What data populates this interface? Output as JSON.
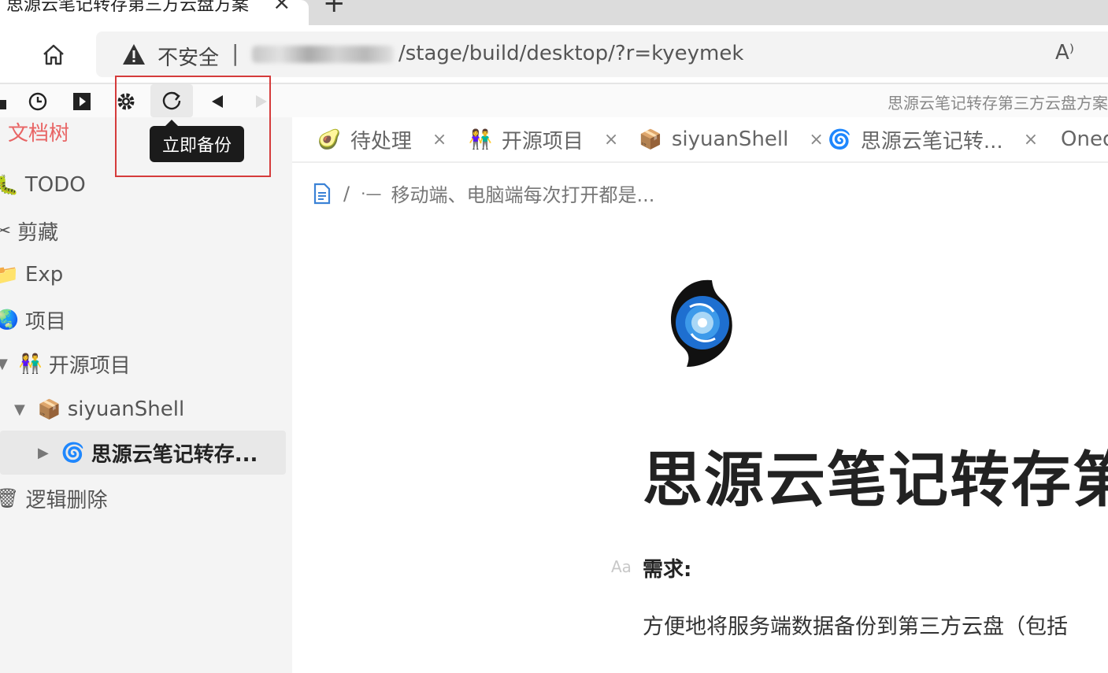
{
  "browser": {
    "tab_title": "思源云笔记转存第三方云盘方案",
    "tab_close": "×",
    "new_tab": "+",
    "insecure_label": "不安全",
    "separator": "|",
    "url_path": "/stage/build/desktop/?r=kyeymek",
    "read_aloud": "A⁾"
  },
  "toolbar": {
    "doc_title": "思源云笔记转存第三方云盘方案",
    "tooltip": "立即备份"
  },
  "sidebar": {
    "title": "文档树",
    "items": [
      {
        "icon": "🐛",
        "label": "TODO"
      },
      {
        "icon": "✂",
        "label": "剪藏"
      },
      {
        "icon": "📁",
        "label": "Exp"
      },
      {
        "icon": "🌏",
        "label": "项目"
      },
      {
        "icon": "👫",
        "label": "开源项目"
      },
      {
        "icon": "📦",
        "label": "siyuanShell"
      },
      {
        "icon": "🌀",
        "label": "思源云笔记转存..."
      },
      {
        "icon": "🗑",
        "label": "逻辑删除"
      }
    ]
  },
  "tabs": [
    {
      "icon": "🥑",
      "label": "待处理"
    },
    {
      "icon": "👫",
      "label": "开源项目"
    },
    {
      "icon": "📦",
      "label": "siyuanShell"
    },
    {
      "icon": "🌀",
      "label": "思源云笔记转..."
    },
    {
      "icon": "",
      "label": "Oned"
    }
  ],
  "tab_close": "×",
  "breadcrumb": {
    "sep": "/",
    "bullet": "·—",
    "text": "移动端、电脑端每次打开都是..."
  },
  "editor": {
    "title": "思源云笔记转存第三方云盘方案",
    "aa": "Aa",
    "heading": "需求:",
    "paragraph": "方便地将服务端数据备份到第三方云盘（包括"
  },
  "colors": {
    "sidebar_title": "#e86464",
    "highlight_box": "#d53b3b",
    "tooltip_bg": "#1b1b1b"
  }
}
